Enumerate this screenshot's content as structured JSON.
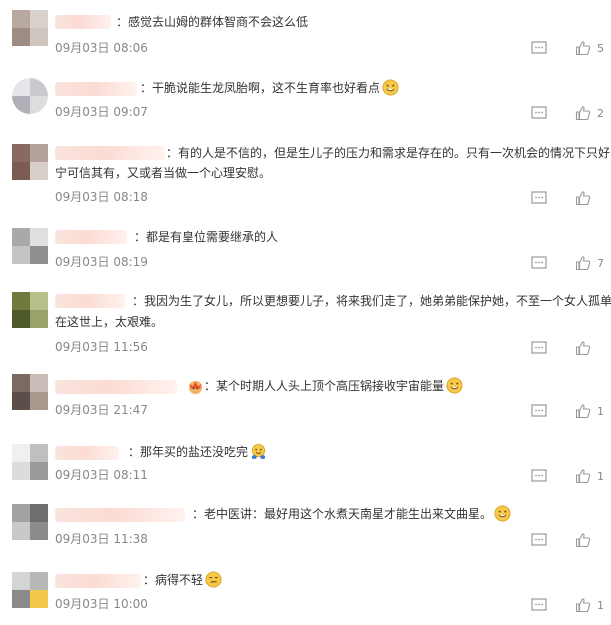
{
  "comments": [
    {
      "text": "：感觉去山姆的群体智商不会这么低",
      "time": "09月03日 08:06",
      "likes": "5",
      "emoji": ""
    },
    {
      "text": "：干脆说能生龙凤胎啊，这不生育率也好看点",
      "time": "09月03日 09:07",
      "likes": "2",
      "emoji": "grinning-face-emoji"
    },
    {
      "text1": "：有的人是不信的，但是生儿子的压力和需求是存在的。只有一次机会的情况下只好",
      "text2": "宁可信其有，又或者当做一个心理安慰。",
      "time": "09月03日 08:18",
      "likes": "",
      "emoji": ""
    },
    {
      "text": "：都是有皇位需要继承的人",
      "time": "09月03日 08:19",
      "likes": "7",
      "emoji": ""
    },
    {
      "text1": "：我因为生了女儿，所以更想要儿子，将来我们走了，她弟弟能保护她，不至一个女人孤单",
      "text2": "在这世上，太艰难。",
      "time": "09月03日 11:56",
      "likes": "",
      "emoji": ""
    },
    {
      "text": "：某个时期人人头上顶个高压锅接收宇宙能量",
      "time": "09月03日 21:47",
      "likes": "1",
      "emoji": "grinning-face-emoji",
      "badge": "crown-badge-emoji"
    },
    {
      "text": "：那年买的盐还没吃完",
      "time": "09月03日 08:11",
      "likes": "1",
      "emoji": "hugging-face-emoji"
    },
    {
      "text": "：老中医讲：最好用这个水煮天南星才能生出来文曲星。",
      "time": "09月03日 11:38",
      "likes": "",
      "emoji": "grinning-face-emoji"
    },
    {
      "text": "：病得不轻",
      "time": "09月03日 10:00",
      "likes": "1",
      "emoji": "smirk-face-emoji"
    }
  ],
  "colors": {
    "time": "#888888",
    "text": "#333333",
    "icon": "#999999"
  }
}
